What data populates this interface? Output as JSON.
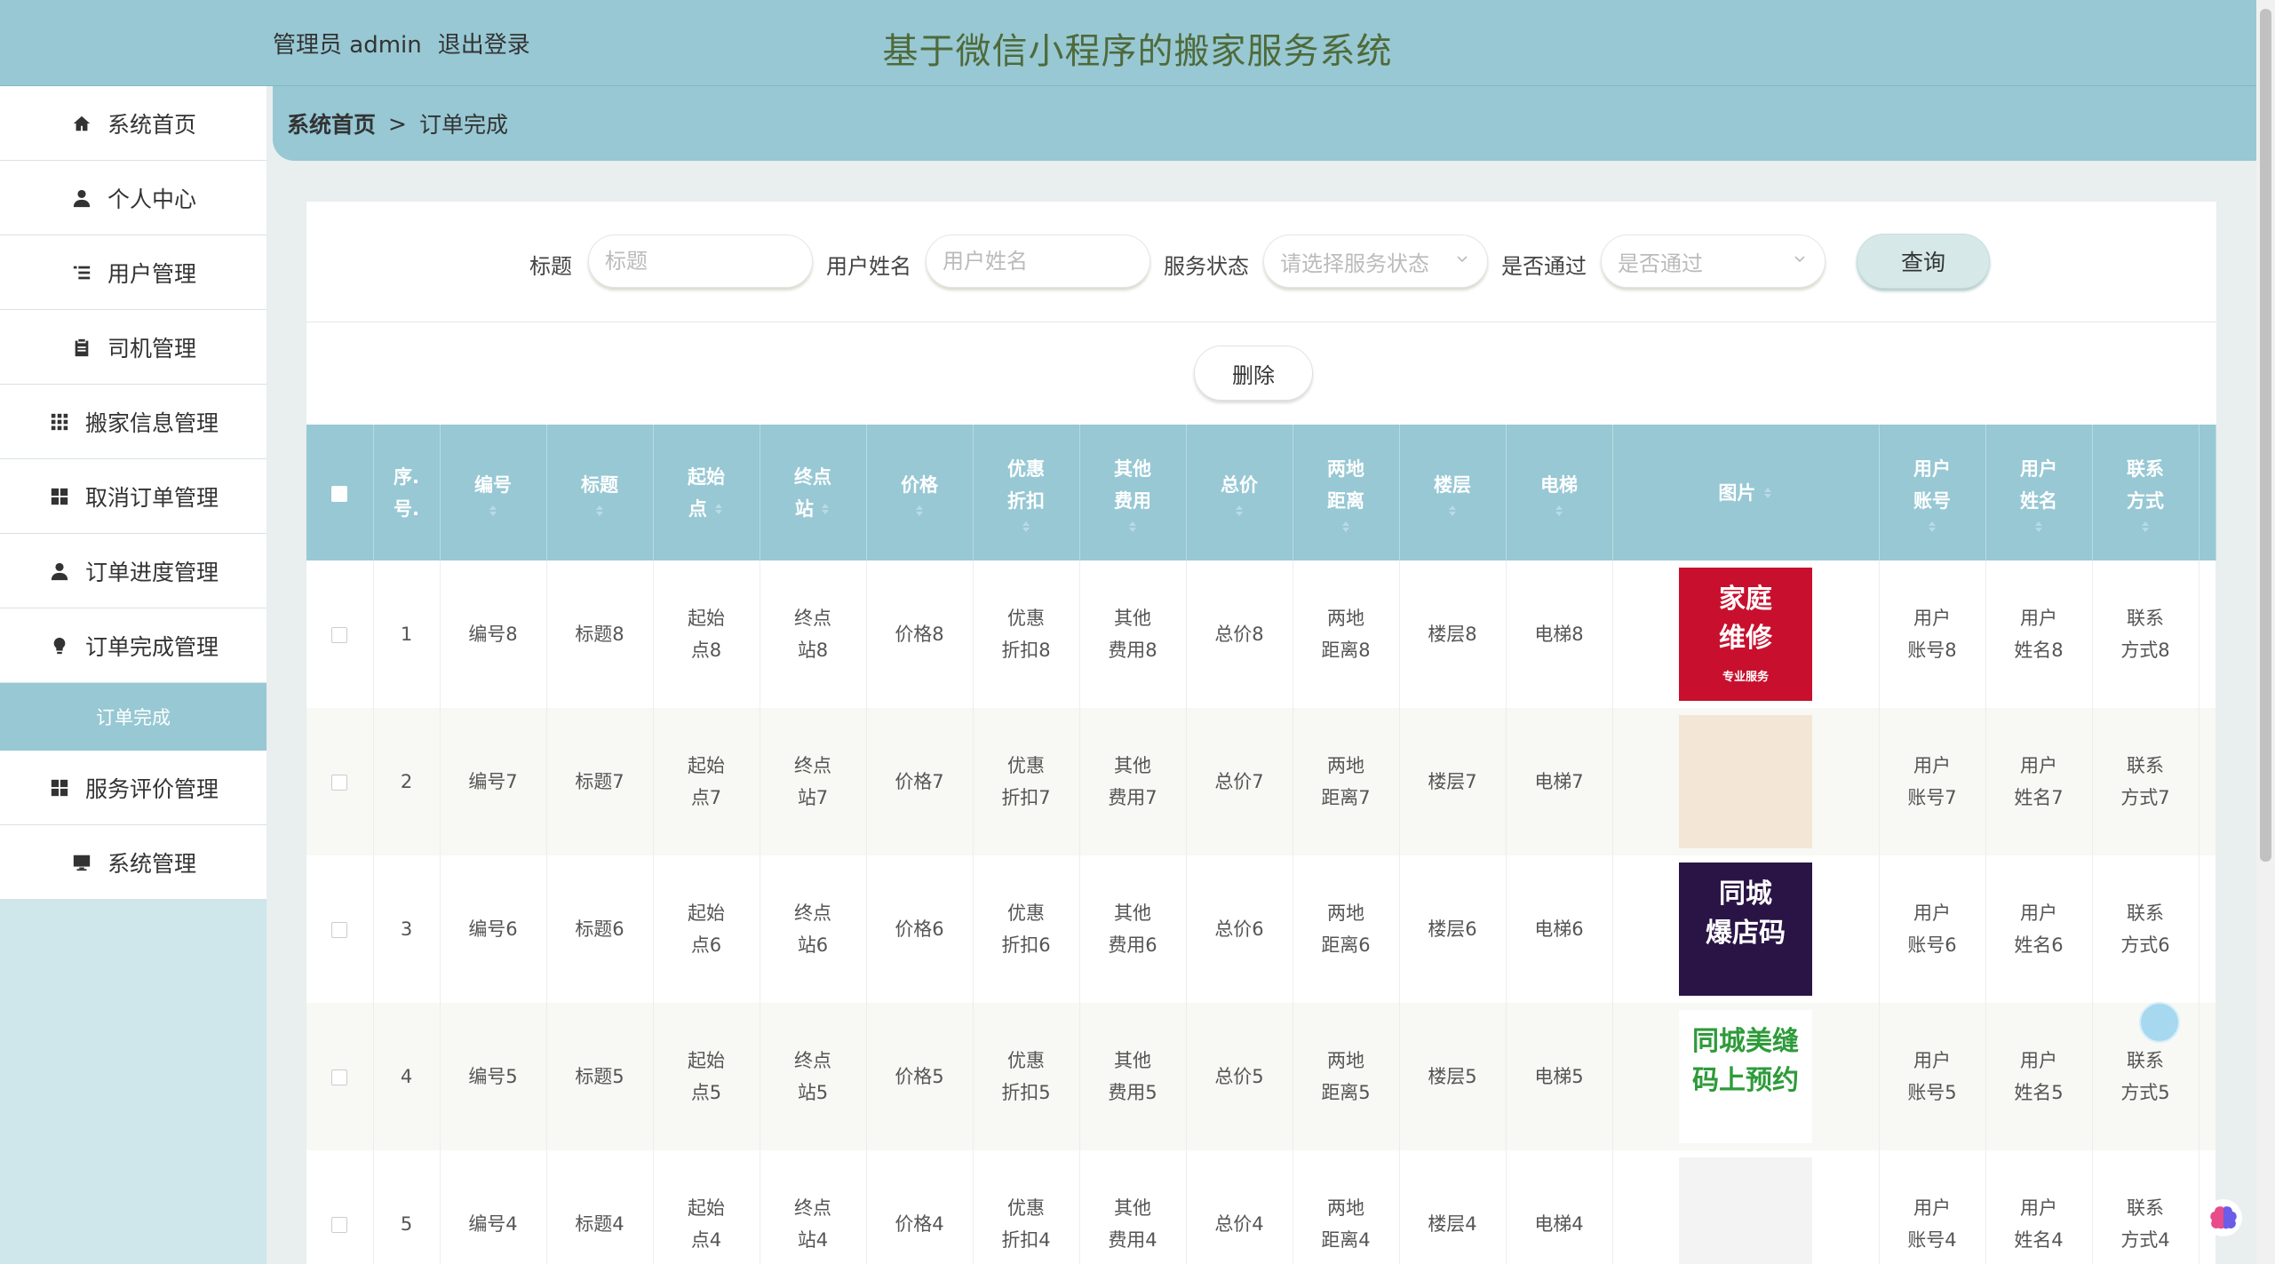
{
  "header": {
    "user_label": "管理员 admin",
    "logout_label": "退出登录",
    "title": "基于微信小程序的搬家服务系统"
  },
  "sidebar": {
    "items": [
      {
        "label": "系统首页",
        "icon": "home-icon"
      },
      {
        "label": "个人中心",
        "icon": "user-icon"
      },
      {
        "label": "用户管理",
        "icon": "list-icon"
      },
      {
        "label": "司机管理",
        "icon": "clipboard-icon"
      },
      {
        "label": "搬家信息管理",
        "icon": "grid-icon"
      },
      {
        "label": "取消订单管理",
        "icon": "apps-icon"
      },
      {
        "label": "订单进度管理",
        "icon": "user-icon"
      },
      {
        "label": "订单完成管理",
        "icon": "bulb-icon"
      },
      {
        "label": "服务评价管理",
        "icon": "apps-icon"
      },
      {
        "label": "系统管理",
        "icon": "monitor-icon"
      }
    ],
    "active_sub": "订单完成"
  },
  "breadcrumb": {
    "home": "系统首页",
    "separator": ">",
    "current": "订单完成"
  },
  "search": {
    "title_label": "标题",
    "title_placeholder": "标题",
    "username_label": "用户姓名",
    "username_placeholder": "用户姓名",
    "status_label": "服务状态",
    "status_placeholder": "请选择服务状态",
    "passed_label": "是否通过",
    "passed_placeholder": "是否通过",
    "query_label": "查询"
  },
  "actions": {
    "delete_label": "删除"
  },
  "table": {
    "headers": [
      {
        "l1": "序.",
        "l2": "号."
      },
      {
        "l1": "编号",
        "l2": ""
      },
      {
        "l1": "标题",
        "l2": ""
      },
      {
        "l1": "起始",
        "l2": "点"
      },
      {
        "l1": "终点",
        "l2": "站"
      },
      {
        "l1": "价格",
        "l2": ""
      },
      {
        "l1": "优惠",
        "l2": "折扣"
      },
      {
        "l1": "其他",
        "l2": "费用"
      },
      {
        "l1": "总价",
        "l2": ""
      },
      {
        "l1": "两地",
        "l2": "距离"
      },
      {
        "l1": "楼层",
        "l2": ""
      },
      {
        "l1": "电梯",
        "l2": ""
      },
      {
        "l1": "图片",
        "l2": ""
      },
      {
        "l1": "用户",
        "l2": "账号"
      },
      {
        "l1": "用户",
        "l2": "姓名"
      },
      {
        "l1": "联系",
        "l2": "方式"
      }
    ],
    "rows": [
      {
        "idx": "1",
        "code": "编号8",
        "title": "标题8",
        "start": [
          "起始",
          "点8"
        ],
        "end": [
          "终点",
          "站8"
        ],
        "price": "价格8",
        "discount": [
          "优惠",
          "折扣8"
        ],
        "other": [
          "其他",
          "费用8"
        ],
        "total": "总价8",
        "distance": [
          "两地",
          "距离8"
        ],
        "floor": "楼层8",
        "elevator": "电梯8",
        "image": {
          "name": "repair-ad-image",
          "lines": [
            "家庭",
            "维修",
            "专业服务"
          ]
        },
        "account": [
          "用户",
          "账号8"
        ],
        "name": [
          "用户",
          "姓名8"
        ],
        "contact": [
          "联系",
          "方式8"
        ]
      },
      {
        "idx": "2",
        "code": "编号7",
        "title": "标题7",
        "start": [
          "起始",
          "点7"
        ],
        "end": [
          "终点",
          "站7"
        ],
        "price": "价格7",
        "discount": [
          "优惠",
          "折扣7"
        ],
        "other": [
          "其他",
          "费用7"
        ],
        "total": "总价7",
        "distance": [
          "两地",
          "距离7"
        ],
        "floor": "楼层7",
        "elevator": "电梯7",
        "image": {
          "name": "mover-worker-image",
          "lines": []
        },
        "account": [
          "用户",
          "账号7"
        ],
        "name": [
          "用户",
          "姓名7"
        ],
        "contact": [
          "联系",
          "方式7"
        ]
      },
      {
        "idx": "3",
        "code": "编号6",
        "title": "标题6",
        "start": [
          "起始",
          "点6"
        ],
        "end": [
          "终点",
          "站6"
        ],
        "price": "价格6",
        "discount": [
          "优惠",
          "折扣6"
        ],
        "other": [
          "其他",
          "费用6"
        ],
        "total": "总价6",
        "distance": [
          "两地",
          "距离6"
        ],
        "floor": "楼层6",
        "elevator": "电梯6",
        "image": {
          "name": "store-code-image",
          "lines": [
            "同城",
            "爆店码"
          ]
        },
        "account": [
          "用户",
          "账号6"
        ],
        "name": [
          "用户",
          "姓名6"
        ],
        "contact": [
          "联系",
          "方式6"
        ]
      },
      {
        "idx": "4",
        "code": "编号5",
        "title": "标题5",
        "start": [
          "起始",
          "点5"
        ],
        "end": [
          "终点",
          "站5"
        ],
        "price": "价格5",
        "discount": [
          "优惠",
          "折扣5"
        ],
        "other": [
          "其他",
          "费用5"
        ],
        "total": "总价5",
        "distance": [
          "两地",
          "距离5"
        ],
        "floor": "楼层5",
        "elevator": "电梯5",
        "image": {
          "name": "tailor-ad-image",
          "lines": [
            "同城美缝",
            "码上预约"
          ]
        },
        "account": [
          "用户",
          "账号5"
        ],
        "name": [
          "用户",
          "姓名5"
        ],
        "contact": [
          "联系",
          "方式5"
        ]
      },
      {
        "idx": "5",
        "code": "编号4",
        "title": "标题4",
        "start": [
          "起始",
          "点4"
        ],
        "end": [
          "终点",
          "站4"
        ],
        "price": "价格4",
        "discount": [
          "优惠",
          "折扣4"
        ],
        "other": [
          "其他",
          "费用4"
        ],
        "total": "总价4",
        "distance": [
          "两地",
          "距离4"
        ],
        "floor": "楼层4",
        "elevator": "电梯4",
        "image": {
          "name": "delivery-truck-image",
          "lines": []
        },
        "account": [
          "用户",
          "账号4"
        ],
        "name": [
          "用户",
          "姓名4"
        ],
        "contact": [
          "联系",
          "方式4"
        ]
      }
    ]
  },
  "colors": {
    "accent": "#97c8d4",
    "sidebar_bg": "#cfe6ea",
    "title_text": "#4f6a3a"
  }
}
